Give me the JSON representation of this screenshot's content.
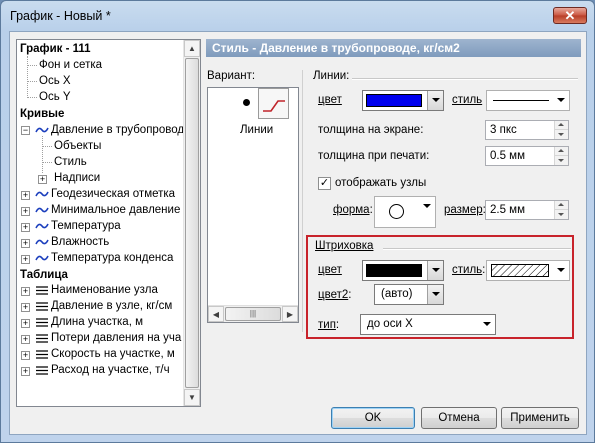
{
  "window": {
    "title": "График - Новый *",
    "close": "✕"
  },
  "tree": {
    "root": "График - 111",
    "root_children": [
      "Фон и сетка",
      "Ось X",
      "Ось Y"
    ],
    "curves_header": "Кривые",
    "curve_expanded": "Давление в трубопровод",
    "curve_children": [
      "Объекты",
      "Стиль"
    ],
    "curve_child_collapsed": "Надписи",
    "curves": [
      "Геодезическая отметка",
      "Минимальное давление",
      "Температура",
      "Влажность",
      "Температура конденса"
    ],
    "table_header": "Таблица",
    "table_items": [
      "Наименование узла",
      "Давление в узле, кг/см",
      "Длина участка, м",
      "Потери давления на уча",
      "Скорость на участке, м",
      "Расход на участке, т/ч"
    ]
  },
  "panel": {
    "title": "Стиль - Давление в трубопроводе, кг/см2",
    "variant_label": "Вариант:",
    "variant_item": "Линии",
    "lines_group": "Линии:",
    "color_label": "цвет",
    "color_value": "#0000ee",
    "style_label": "стиль",
    "screen_width_label": "толщина на экране:",
    "screen_width_value": "3 пкс",
    "print_width_label": "толщина при печати:",
    "print_width_value": "0.5 мм",
    "show_nodes_label": "отображать узлы",
    "show_nodes_checked": true,
    "shape_label": "форма",
    "size_label": "размер",
    "size_value": "2.5 мм",
    "hatch_group": "Штриховка",
    "hatch_color_label": "цвет",
    "hatch_color_value": "#000000",
    "hatch_style_label": "стиль",
    "color2_label": "цвет2",
    "color2_value": "(авто)",
    "type_label": "тип",
    "type_value": "до оси X"
  },
  "buttons": {
    "ok": "OK",
    "cancel": "Отмена",
    "apply": "Применить"
  }
}
